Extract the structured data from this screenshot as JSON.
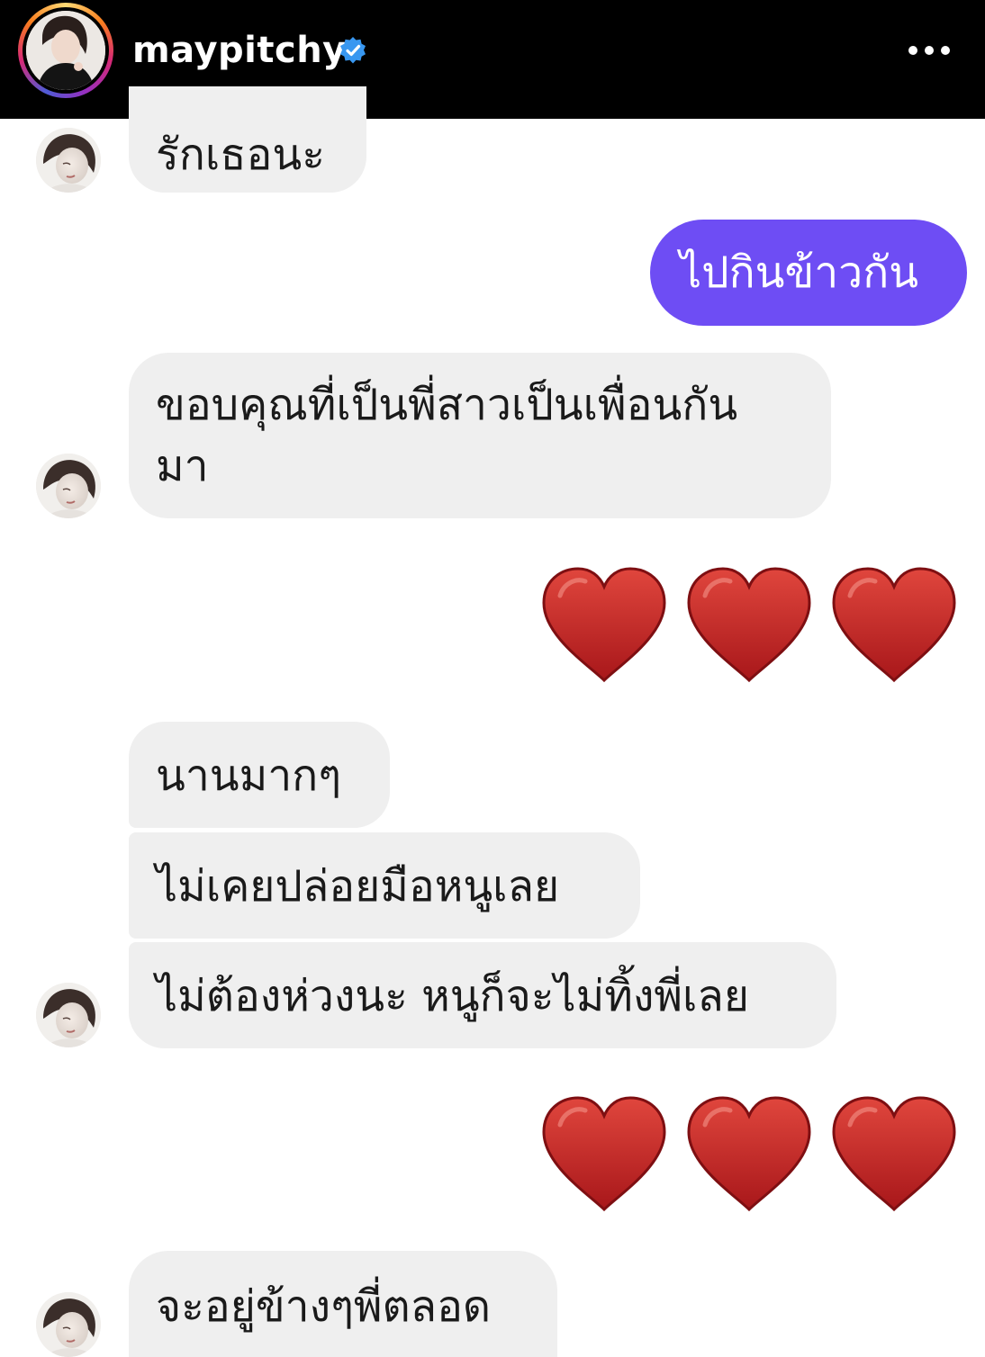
{
  "header": {
    "username": "maypitchy",
    "verified_icon": "verified-badge-icon",
    "more_icon": "more-options-icon"
  },
  "messages": {
    "m1": "รักเธอนะ",
    "m2": "ไปกินข้าวกัน",
    "m3_line1": "ขอบคุณที่เป็นพี่สาวเป็นเพื่อนกัน",
    "m3_line2": "มา",
    "m4": "❤️❤️❤️",
    "m5": "นานมากๆ",
    "m6": "ไม่เคยปล่อยมือหนูเลย",
    "m7": "ไม่ต้องห่วงนะ หนูก็จะไม่ทิ้งพี่เลย",
    "m8": "❤️❤️❤️",
    "m9": "จะอยู่ข้างๆพี่ตลอด"
  },
  "colors": {
    "header_bg": "#000000",
    "incoming_bubble": "#efefef",
    "outgoing_bubble": "#6e4df4",
    "verified_blue": "#3897f0",
    "heart_red": "#c62a23"
  }
}
